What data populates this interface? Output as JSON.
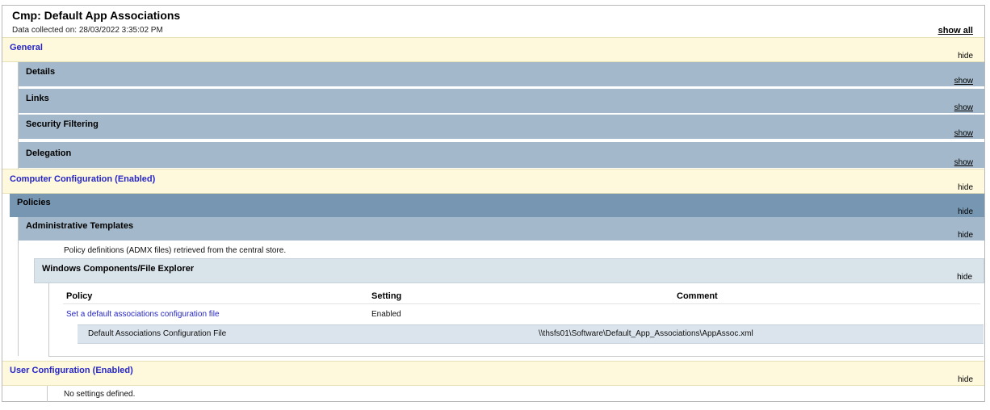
{
  "report": {
    "title": "Cmp: Default App Associations",
    "collected": "Data collected on: 28/03/2022 3:35:02 PM",
    "show_all": "show all"
  },
  "general": {
    "label": "General",
    "toggle": "hide",
    "details": {
      "label": "Details",
      "toggle": "show"
    },
    "links": {
      "label": "Links",
      "toggle": "show"
    },
    "security": {
      "label": "Security Filtering",
      "toggle": "show"
    },
    "delegation": {
      "label": "Delegation",
      "toggle": "show"
    }
  },
  "computer": {
    "label": "Computer Configuration (Enabled)",
    "toggle": "hide",
    "policies": {
      "label": "Policies",
      "toggle": "hide"
    },
    "admin_templates": {
      "label": "Administrative Templates",
      "toggle": "hide",
      "note": "Policy definitions (ADMX files) retrieved from the central store."
    },
    "file_explorer": {
      "label": "Windows Components/File Explorer",
      "toggle": "hide",
      "columns": [
        "Policy",
        "Setting",
        "Comment"
      ],
      "policy_name": "Set a default associations configuration file",
      "policy_setting": "Enabled",
      "sub_label": "Default Associations Configuration File",
      "sub_value": "\\\\thsfs01\\Software\\Default_App_Associations\\AppAssoc.xml"
    }
  },
  "user": {
    "label": "User Configuration (Enabled)",
    "toggle": "hide",
    "note": "No settings defined."
  }
}
